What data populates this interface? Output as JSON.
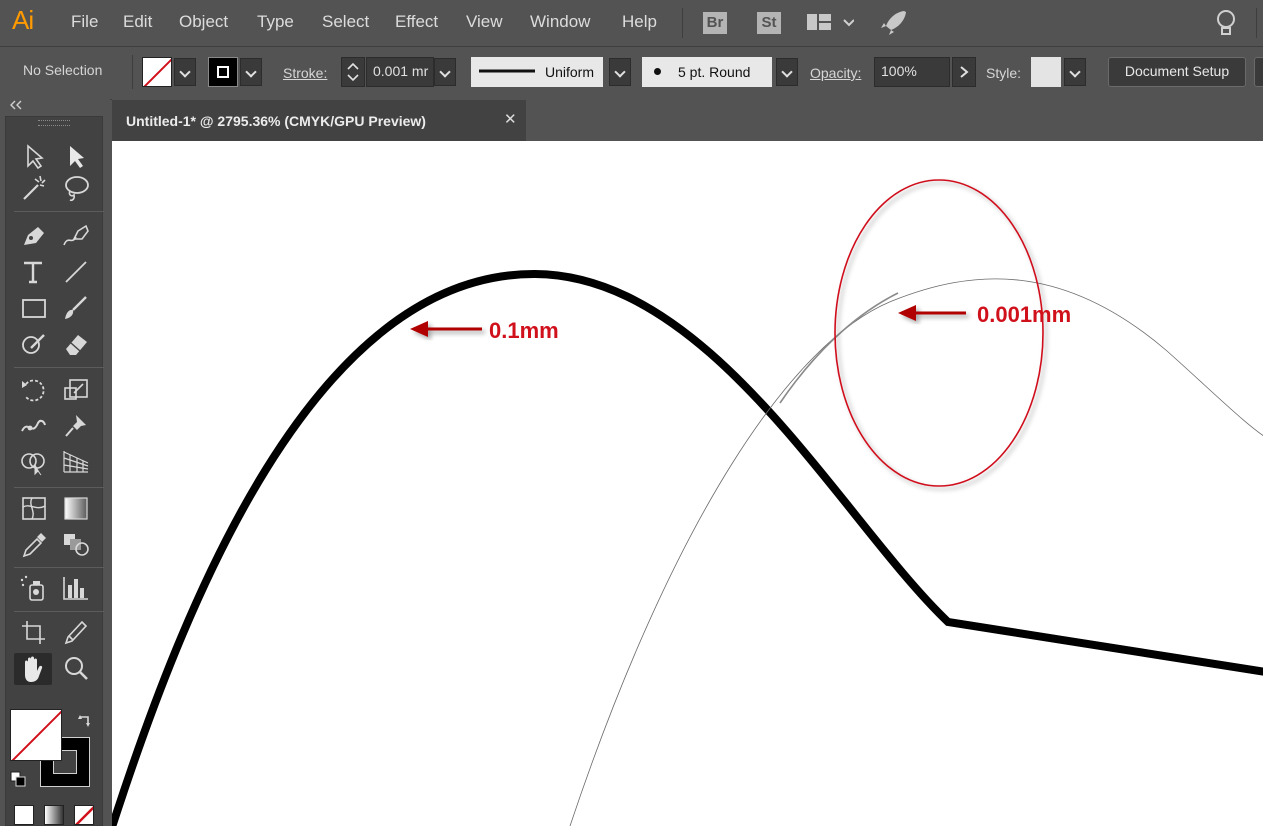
{
  "app": {
    "logo": "Ai"
  },
  "menu": [
    "File",
    "Edit",
    "Object",
    "Type",
    "Select",
    "Effect",
    "View",
    "Window",
    "Help"
  ],
  "apps": {
    "bridge": "Br",
    "stock": "St"
  },
  "control": {
    "selection": "No Selection",
    "stroke_label": "Stroke:",
    "stroke_value": "0.001 mr",
    "profile": "Uniform",
    "brush": "5 pt. Round",
    "opacity_label": "Opacity:",
    "opacity_value": "100%",
    "style_label": "Style:",
    "doc_setup": "Document Setup"
  },
  "document": {
    "tab_title": "Untitled-1* @ 2795.36% (CMYK/GPU Preview)"
  },
  "annotations": {
    "thick": "0.1mm",
    "thin": "0.001mm"
  },
  "colors": {
    "accent": "#ff9a00",
    "annotation": "#d0111b",
    "panel": "#535353",
    "panel_dark": "#424242"
  }
}
